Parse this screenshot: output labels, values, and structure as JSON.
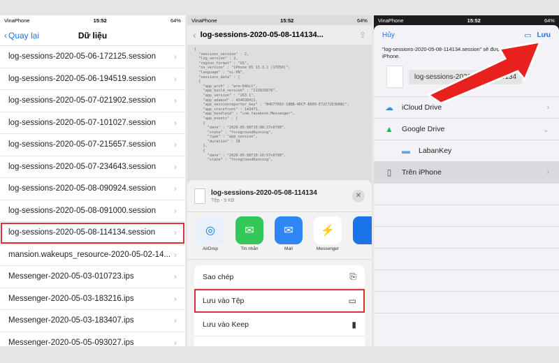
{
  "status": {
    "left": {
      "carrier": "VinaPhone",
      "time": "15:52",
      "battery": "64%"
    },
    "middle": {
      "carrier": "VinaPhone",
      "time": "15:52",
      "battery": "64%"
    },
    "right": {
      "carrier": "VinaPhone",
      "time": "15:52",
      "battery": "64%"
    }
  },
  "panel1": {
    "back_label": "Quay lại",
    "title": "Dữ liệu",
    "files": [
      "log-sessions-2020-05-06-172125.session",
      "log-sessions-2020-05-06-194519.session",
      "log-sessions-2020-05-07-021902.session",
      "log-sessions-2020-05-07-101027.session",
      "log-sessions-2020-05-07-215657.session",
      "log-sessions-2020-05-07-234643.session",
      "log-sessions-2020-05-08-090924.session",
      "log-sessions-2020-05-08-091000.session",
      "log-sessions-2020-05-08-114134.session",
      "mansion.wakeups_resource-2020-05-02-14...",
      "Messenger-2020-05-03-010723.ips",
      "Messenger-2020-05-03-183216.ips",
      "Messenger-2020-05-03-183407.ips",
      "Messenger-2020-05-05-093027.ips"
    ]
  },
  "panel2": {
    "title": "log-sessions-2020-05-08-114134...",
    "code": "{\n  \"sessions_version\" : 2,\n  \"log_version\" : 2,\n  \"region_format\" : \"US\",\n  \"os_version\" : \"iPhone OS 13.3.1 (17D50)\",\n  \"language\" : \"vi-VN\",\n  \"sessions_data\" : [\n  {\n    \"app_arch\" : \"arm-64bit\",\n    \"app_build_version\" : \"213025676\",\n    \"app_version\" : \"263.1\",\n    \"app_adamid\" : 454638411,\n    \"app_sessionreporter_key\" : \"B4D77D92-18BB-4DCF-8609-E72C72E3DB8C\",\n    \"app_storefront\" : 143471,\n    \"app_bundleid\" : \"com.facebook.Messenger\",\n    \"app_events\" : [\n    {\n      \"date\" : \"2020-05-08T10:08:27+0700\",\n      \"state\" : \"foregroundRunning\",\n      \"type\" : \"app_session\",\n      \"duration\" : 18\n    },\n    {\n      \"date\" : \"2020-05-08T10:10:57+0700\",\n      \"state\" : \"foregroundRunning\",",
    "file_name": "log-sessions-2020-05-08-114134",
    "file_size": "Tệp - 9 KB",
    "apps": [
      {
        "label": "AirDrop",
        "color": "#e8f0fb",
        "glyph": "◎",
        "fg": "#1a73e8"
      },
      {
        "label": "Tin nhắn",
        "color": "#34c759",
        "glyph": "✉",
        "fg": "#ffffff"
      },
      {
        "label": "Mail",
        "color": "#2e86f5",
        "glyph": "✉",
        "fg": "#ffffff"
      },
      {
        "label": "Messenger",
        "color": "#ffffff",
        "glyph": "⚡",
        "fg": "#1a73e8"
      },
      {
        "label": "",
        "color": "#1a73e8",
        "glyph": "",
        "fg": "#ffffff"
      }
    ],
    "actions": [
      {
        "label": "Sao chép",
        "icon": "⎘"
      },
      {
        "label": "Lưu vào Tệp",
        "icon": "▭"
      },
      {
        "label": "Lưu vào Keep",
        "icon": "▮"
      },
      {
        "label": "",
        "icon": ""
      }
    ]
  },
  "panel3": {
    "cancel_label": "Hủy",
    "save_label": "Lưu",
    "message": "\"log-sessions-2020-05-08-114134.session\" sẽ được lưu vào Trên iPhone.",
    "preview_name": "log-sessions-2020-05-08-114134",
    "locations": [
      {
        "label": "iCloud Drive",
        "icon": "☁",
        "color": "#3b8df0",
        "sub": false,
        "sel": false,
        "chevron": "›"
      },
      {
        "label": "Google Drive",
        "icon": "▲",
        "color": "#34a853",
        "sub": false,
        "sel": false,
        "chevron": "⌄"
      },
      {
        "label": "LabanKey",
        "icon": "▬",
        "color": "#5aa9e6",
        "sub": true,
        "sel": false,
        "chevron": ""
      },
      {
        "label": "Trên iPhone",
        "icon": "▯",
        "color": "#555555",
        "sub": false,
        "sel": true,
        "chevron": "›"
      }
    ]
  }
}
